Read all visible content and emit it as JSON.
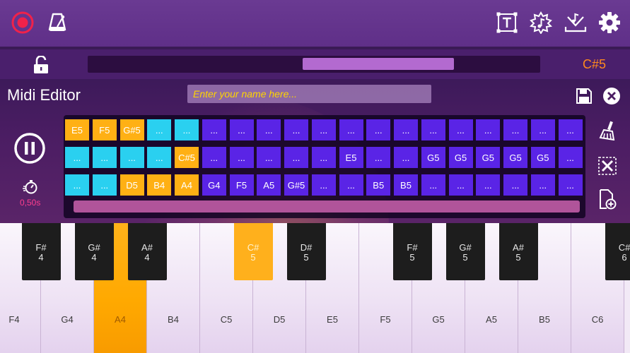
{
  "colors": {
    "record": "#f0224a",
    "note_display": "#ff8a1e",
    "placeholder": "#ffd400",
    "timing": "#ff3e8e",
    "cell_orange": "#ffb014",
    "cell_cyan": "#2ad0f0",
    "cell_purple": "#5a24e6",
    "active_key": "#ffb01c"
  },
  "toolbar": {
    "left_icons": [
      "record-icon",
      "metronome-icon"
    ],
    "right_icons": [
      "text-icon",
      "music-note-burst-icon",
      "download-music-icon",
      "gear-icon"
    ]
  },
  "player": {
    "lock_icon": "unlock-icon",
    "current_note": "C#5",
    "progress_start": 0.475,
    "progress_end": 0.81
  },
  "editor": {
    "title": "Midi Editor",
    "name_placeholder": "Enter your name here...",
    "timing": "0,50s",
    "side_icons": [
      "broom-icon",
      "close-box-icon",
      "add-file-icon"
    ],
    "rows": [
      [
        {
          "t": "E5",
          "c": "orange"
        },
        {
          "t": "F5",
          "c": "orange"
        },
        {
          "t": "G#5",
          "c": "orange"
        },
        {
          "t": "...",
          "c": "cyan"
        },
        {
          "t": "...",
          "c": "cyan"
        },
        {
          "t": "...",
          "c": "purple"
        },
        {
          "t": "...",
          "c": "purple"
        },
        {
          "t": "...",
          "c": "purple"
        },
        {
          "t": "...",
          "c": "purple"
        },
        {
          "t": "...",
          "c": "purple"
        },
        {
          "t": "...",
          "c": "purple"
        },
        {
          "t": "...",
          "c": "purple"
        },
        {
          "t": "...",
          "c": "purple"
        },
        {
          "t": "...",
          "c": "purple"
        },
        {
          "t": "...",
          "c": "purple"
        },
        {
          "t": "...",
          "c": "purple"
        },
        {
          "t": "...",
          "c": "purple"
        },
        {
          "t": "...",
          "c": "purple"
        },
        {
          "t": "...",
          "c": "purple"
        }
      ],
      [
        {
          "t": "...",
          "c": "cyan"
        },
        {
          "t": "...",
          "c": "cyan"
        },
        {
          "t": "...",
          "c": "cyan"
        },
        {
          "t": "...",
          "c": "cyan"
        },
        {
          "t": "C#5",
          "c": "orange"
        },
        {
          "t": "...",
          "c": "purple"
        },
        {
          "t": "...",
          "c": "purple"
        },
        {
          "t": "...",
          "c": "purple"
        },
        {
          "t": "...",
          "c": "purple"
        },
        {
          "t": "...",
          "c": "purple"
        },
        {
          "t": "E5",
          "c": "purple"
        },
        {
          "t": "...",
          "c": "purple"
        },
        {
          "t": "...",
          "c": "purple"
        },
        {
          "t": "G5",
          "c": "purple"
        },
        {
          "t": "G5",
          "c": "purple"
        },
        {
          "t": "G5",
          "c": "purple"
        },
        {
          "t": "G5",
          "c": "purple"
        },
        {
          "t": "G5",
          "c": "purple"
        },
        {
          "t": "...",
          "c": "purple"
        }
      ],
      [
        {
          "t": "...",
          "c": "cyan"
        },
        {
          "t": "...",
          "c": "cyan"
        },
        {
          "t": "D5",
          "c": "orange"
        },
        {
          "t": "B4",
          "c": "orange"
        },
        {
          "t": "A4",
          "c": "orange"
        },
        {
          "t": "G4",
          "c": "purple"
        },
        {
          "t": "F5",
          "c": "purple"
        },
        {
          "t": "A5",
          "c": "purple"
        },
        {
          "t": "G#5",
          "c": "purple"
        },
        {
          "t": "...",
          "c": "purple"
        },
        {
          "t": "...",
          "c": "purple"
        },
        {
          "t": "B5",
          "c": "purple"
        },
        {
          "t": "B5",
          "c": "purple"
        },
        {
          "t": "...",
          "c": "purple"
        },
        {
          "t": "...",
          "c": "purple"
        },
        {
          "t": "...",
          "c": "purple"
        },
        {
          "t": "...",
          "c": "purple"
        },
        {
          "t": "...",
          "c": "purple"
        },
        {
          "t": "...",
          "c": "purple"
        }
      ]
    ]
  },
  "piano": {
    "white_keys": [
      {
        "label": "F4",
        "active": false
      },
      {
        "label": "G4",
        "active": false
      },
      {
        "label": "A4",
        "active": true
      },
      {
        "label": "B4",
        "active": false
      },
      {
        "label": "C5",
        "active": false
      },
      {
        "label": "D5",
        "active": false
      },
      {
        "label": "E5",
        "active": false
      },
      {
        "label": "F5",
        "active": false
      },
      {
        "label": "G5",
        "active": false
      },
      {
        "label": "A5",
        "active": false
      },
      {
        "label": "B5",
        "active": false
      },
      {
        "label": "C6",
        "active": false
      }
    ],
    "black_keys": [
      {
        "note": "F#",
        "octave": "4",
        "active": false
      },
      {
        "note": "G#",
        "octave": "4",
        "active": false
      },
      {
        "note": "A#",
        "octave": "4",
        "active": false
      },
      {
        "note": "C#",
        "octave": "5",
        "active": true
      },
      {
        "note": "D#",
        "octave": "5",
        "active": false
      },
      {
        "note": "F#",
        "octave": "5",
        "active": false
      },
      {
        "note": "G#",
        "octave": "5",
        "active": false
      },
      {
        "note": "A#",
        "octave": "5",
        "active": false
      },
      {
        "note": "C#",
        "octave": "6",
        "active": false
      }
    ]
  }
}
